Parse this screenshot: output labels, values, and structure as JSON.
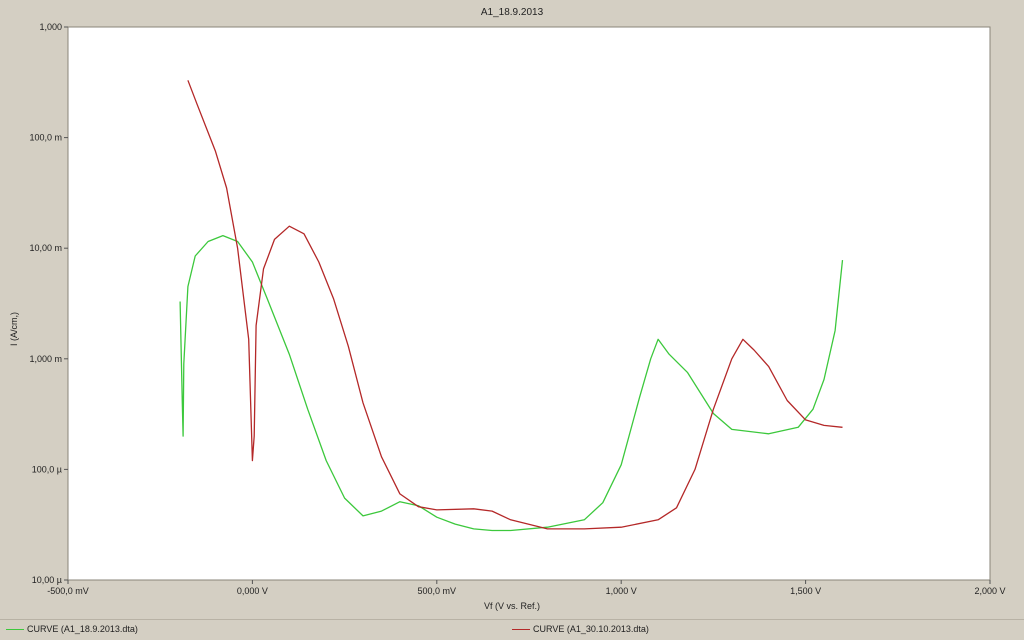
{
  "chart_data": {
    "type": "line",
    "title": "A1_18.9.2013",
    "xlabel": "Vf (V vs. Ref.)",
    "ylabel": "I (A/cm,)",
    "xlim": [
      -0.5,
      2.0
    ],
    "ylim": [
      1e-05,
      1.0
    ],
    "y_scale": "log",
    "grid": false,
    "legend_position": "bottom",
    "x_ticks": [
      {
        "value": -0.5,
        "label": "-500,0 mV"
      },
      {
        "value": 0.0,
        "label": "0,000 V"
      },
      {
        "value": 0.5,
        "label": "500,0 mV"
      },
      {
        "value": 1.0,
        "label": "1,000 V"
      },
      {
        "value": 1.5,
        "label": "1,500 V"
      },
      {
        "value": 2.0,
        "label": "2,000 V"
      }
    ],
    "y_ticks": [
      {
        "value": 1e-05,
        "label": "10,00 µ"
      },
      {
        "value": 0.0001,
        "label": "100,0 µ"
      },
      {
        "value": 0.001,
        "label": "1,000 m"
      },
      {
        "value": 0.01,
        "label": "10,00 m"
      },
      {
        "value": 0.1,
        "label": "100,0 m"
      },
      {
        "value": 1.0,
        "label": "1,000"
      }
    ],
    "series": [
      {
        "name": "CURVE (A1_18.9.2013.dta)",
        "color": "#3cc83c",
        "points": [
          [
            -0.196,
            0.0033
          ],
          [
            -0.19,
            0.0004
          ],
          [
            -0.188,
            0.0002
          ],
          [
            -0.186,
            0.0009
          ],
          [
            -0.175,
            0.0045
          ],
          [
            -0.155,
            0.0085
          ],
          [
            -0.12,
            0.0115
          ],
          [
            -0.08,
            0.013
          ],
          [
            -0.04,
            0.0115
          ],
          [
            0.0,
            0.0075
          ],
          [
            0.04,
            0.0035
          ],
          [
            0.1,
            0.0011
          ],
          [
            0.15,
            0.00035
          ],
          [
            0.2,
            0.00012
          ],
          [
            0.25,
            5.5e-05
          ],
          [
            0.3,
            3.8e-05
          ],
          [
            0.35,
            4.2e-05
          ],
          [
            0.4,
            5.1e-05
          ],
          [
            0.45,
            4.7e-05
          ],
          [
            0.5,
            3.7e-05
          ],
          [
            0.55,
            3.2e-05
          ],
          [
            0.6,
            2.9e-05
          ],
          [
            0.65,
            2.8e-05
          ],
          [
            0.7,
            2.8e-05
          ],
          [
            0.8,
            3e-05
          ],
          [
            0.9,
            3.5e-05
          ],
          [
            0.95,
            5e-05
          ],
          [
            1.0,
            0.00011
          ],
          [
            1.05,
            0.00045
          ],
          [
            1.08,
            0.001
          ],
          [
            1.1,
            0.0015
          ],
          [
            1.13,
            0.0011
          ],
          [
            1.18,
            0.00075
          ],
          [
            1.25,
            0.00032
          ],
          [
            1.3,
            0.00023
          ],
          [
            1.4,
            0.00021
          ],
          [
            1.48,
            0.00024
          ],
          [
            1.52,
            0.00035
          ],
          [
            1.55,
            0.00065
          ],
          [
            1.58,
            0.0018
          ],
          [
            1.6,
            0.0078
          ]
        ]
      },
      {
        "name": "CURVE (A1_30.10.2013.dta)",
        "color": "#b42828",
        "points": [
          [
            -0.175,
            0.33
          ],
          [
            -0.15,
            0.2
          ],
          [
            -0.1,
            0.075
          ],
          [
            -0.07,
            0.035
          ],
          [
            -0.04,
            0.01
          ],
          [
            -0.01,
            0.0015
          ],
          [
            0.0,
            0.00012
          ],
          [
            0.005,
            0.0002
          ],
          [
            0.01,
            0.002
          ],
          [
            0.03,
            0.0065
          ],
          [
            0.06,
            0.012
          ],
          [
            0.1,
            0.0158
          ],
          [
            0.14,
            0.0135
          ],
          [
            0.18,
            0.0075
          ],
          [
            0.22,
            0.0035
          ],
          [
            0.26,
            0.0013
          ],
          [
            0.3,
            0.0004
          ],
          [
            0.35,
            0.00013
          ],
          [
            0.4,
            6e-05
          ],
          [
            0.45,
            4.6e-05
          ],
          [
            0.5,
            4.3e-05
          ],
          [
            0.6,
            4.4e-05
          ],
          [
            0.65,
            4.2e-05
          ],
          [
            0.7,
            3.5e-05
          ],
          [
            0.8,
            2.9e-05
          ],
          [
            0.9,
            2.9e-05
          ],
          [
            1.0,
            3e-05
          ],
          [
            1.1,
            3.5e-05
          ],
          [
            1.15,
            4.5e-05
          ],
          [
            1.2,
            0.0001
          ],
          [
            1.25,
            0.00035
          ],
          [
            1.3,
            0.001
          ],
          [
            1.33,
            0.0015
          ],
          [
            1.36,
            0.0012
          ],
          [
            1.4,
            0.00085
          ],
          [
            1.45,
            0.00042
          ],
          [
            1.5,
            0.00028
          ],
          [
            1.55,
            0.00025
          ],
          [
            1.6,
            0.00024
          ]
        ]
      }
    ]
  }
}
